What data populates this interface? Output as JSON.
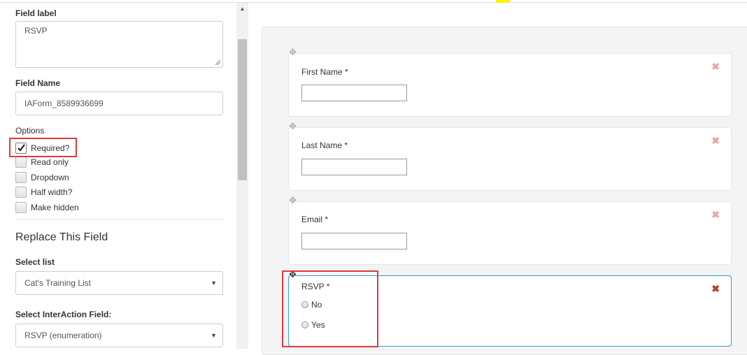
{
  "left_panel": {
    "field_label_heading": "Field label",
    "field_label_value": "RSVP",
    "field_name_heading": "Field Name",
    "field_name_value": "IAForm_8589936699",
    "options_heading": "Options",
    "options": [
      {
        "label": "Required?",
        "checked": true
      },
      {
        "label": "Read only",
        "checked": false
      },
      {
        "label": "Dropdown",
        "checked": false
      },
      {
        "label": "Half width?",
        "checked": false
      },
      {
        "label": "Make hidden",
        "checked": false
      }
    ],
    "replace_section_title": "Replace This Field",
    "select_list_heading": "Select list",
    "select_list_value": "Cat's Training List",
    "select_ia_heading": "Select InterAction Field:",
    "select_ia_value": "RSVP (enumeration)"
  },
  "form_fields": [
    {
      "label": "First Name *",
      "type": "text"
    },
    {
      "label": "Last Name *",
      "type": "text"
    },
    {
      "label": "Email *",
      "type": "text"
    },
    {
      "label": "RSVP *",
      "type": "radio",
      "options": [
        "No",
        "Yes"
      ]
    }
  ],
  "icons": {
    "move": "move-icon",
    "close": "close-icon",
    "caret": "chevron-down-icon"
  },
  "colors": {
    "highlight_red": "#e03a3e",
    "active_border": "#2a9fd0",
    "close_active": "#c0392b",
    "close_inactive": "#e8a8a8"
  }
}
